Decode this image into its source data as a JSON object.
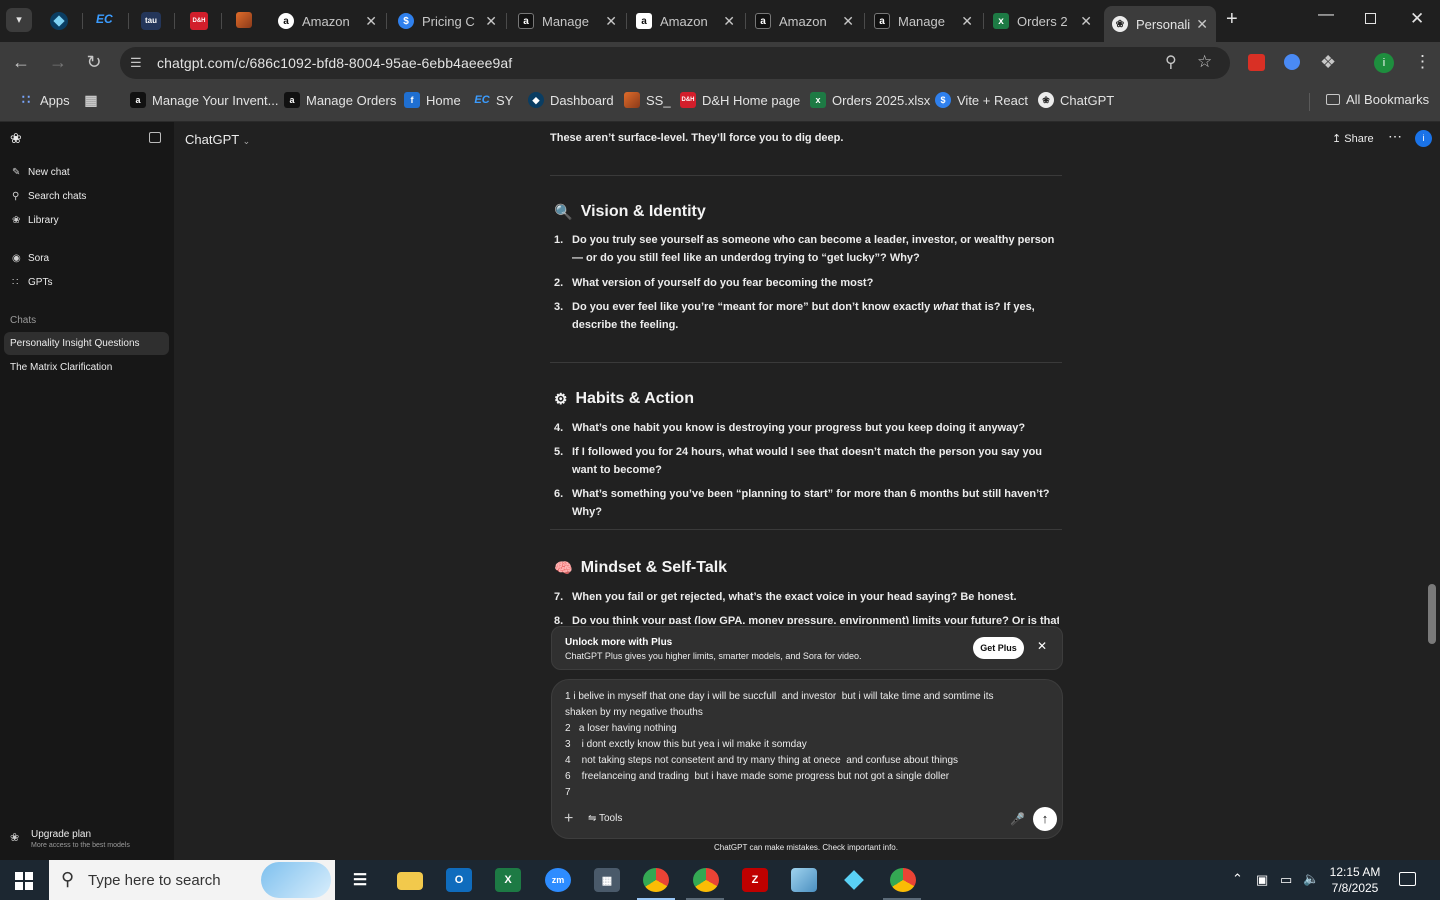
{
  "browser": {
    "tabs": [
      {
        "label": "Amazon",
        "icon": "amazon-icon"
      },
      {
        "label": "Pricing C",
        "icon": "dollar-icon"
      },
      {
        "label": "Manage",
        "icon": "amazon-icon"
      },
      {
        "label": "Amazon",
        "icon": "amazon-icon"
      },
      {
        "label": "Amazon",
        "icon": "amazon-icon"
      },
      {
        "label": "Manage",
        "icon": "amazon-icon"
      },
      {
        "label": "Orders 2",
        "icon": "excel-icon"
      },
      {
        "label": "Personali",
        "icon": "chatgpt-icon"
      }
    ],
    "pinned_tab_texts": [
      "EC",
      "tau",
      "D&H"
    ],
    "url": "chatgpt.com/c/686c1092-bfd8-8004-95ae-6ebb4aeee9af",
    "bookmarks": [
      {
        "label": "Apps"
      },
      {
        "label": "Manage Your Invent..."
      },
      {
        "label": "Manage Orders"
      },
      {
        "label": "Home"
      },
      {
        "label": "SY"
      },
      {
        "label": "Dashboard"
      },
      {
        "label": "SS_"
      },
      {
        "label": "D&H Home page"
      },
      {
        "label": "Orders 2025.xlsx"
      },
      {
        "label": "Vite + React"
      },
      {
        "label": "ChatGPT"
      }
    ],
    "all_bookmarks": "All Bookmarks",
    "profile_initial": "i"
  },
  "sidebar": {
    "items": [
      {
        "label": "New chat"
      },
      {
        "label": "Search chats"
      },
      {
        "label": "Library"
      },
      {
        "label": "Sora"
      },
      {
        "label": "GPTs"
      }
    ],
    "chats_heading": "Chats",
    "chats": [
      {
        "label": "Personality Insight Questions",
        "active": true
      },
      {
        "label": "The Matrix Clarification",
        "active": false
      }
    ],
    "upgrade": {
      "title": "Upgrade plan",
      "subtitle": "More access to the best models"
    }
  },
  "header": {
    "model": "ChatGPT",
    "share": "Share",
    "user_initial": "i"
  },
  "conversation": {
    "intro": "These aren’t surface-level. They’ll force you to dig deep.",
    "sections": [
      {
        "title": "Vision & Identity",
        "emoji": "🔍",
        "questions": [
          {
            "num": "1.",
            "text": "Do you truly see yourself as someone who can become a leader, investor, or wealthy person — or do you still feel like an underdog trying to “get lucky”? Why?"
          },
          {
            "num": "2.",
            "text": "What version of yourself do you fear becoming the most?"
          },
          {
            "num": "3.",
            "text_before": "Do you ever feel like you’re “meant for more” but don’t know exactly ",
            "text_em": "what",
            "text_after": " that is? If yes, describe the feeling."
          }
        ]
      },
      {
        "title": "Habits & Action",
        "emoji": "⚙",
        "questions": [
          {
            "num": "4.",
            "text": "What’s one habit you know is destroying your progress but you keep doing it anyway?"
          },
          {
            "num": "5.",
            "text": "If I followed you for 24 hours, what would I see that doesn’t match the person you say you want to become?"
          },
          {
            "num": "6.",
            "text": "What’s something you’ve been “planning to start” for more than 6 months but still haven’t? Why?"
          }
        ]
      },
      {
        "title": "Mindset & Self-Talk",
        "emoji": "🧠",
        "questions": [
          {
            "num": "7.",
            "text": "When you fail or get rejected, what’s the exact voice in your head saying? Be honest."
          },
          {
            "num": "8.",
            "text": "Do you think your past (low GPA, money pressure, environment) limits your future? Or is that just an"
          }
        ]
      }
    ]
  },
  "banner": {
    "title": "Unlock more with Plus",
    "subtitle": "ChatGPT Plus gives you higher limits, smarter models, and Sora for video.",
    "cta": "Get Plus"
  },
  "composer": {
    "lines": [
      "1 i belive in myself that one day i will be succfull  and investor  but i will take time and somtime its",
      "shaken by my negative thouths",
      "2   a loser having nothing",
      "3    i dont exctly know this but yea i wil make it somday",
      "4    not taking steps not consetent and try many thing at onece  and confuse about things",
      "6    freelanceing and trading  but i have made some progress but not got a single doller",
      "7"
    ],
    "tools": "Tools"
  },
  "footnote": "ChatGPT can make mistakes. Check important info.",
  "taskbar": {
    "search_placeholder": "Type here to search",
    "time": "12:15 AM",
    "date": "7/8/2025"
  },
  "colors": {
    "bg": "#212121",
    "sidebar": "#171717",
    "accent_blue": "#1a73e8"
  }
}
